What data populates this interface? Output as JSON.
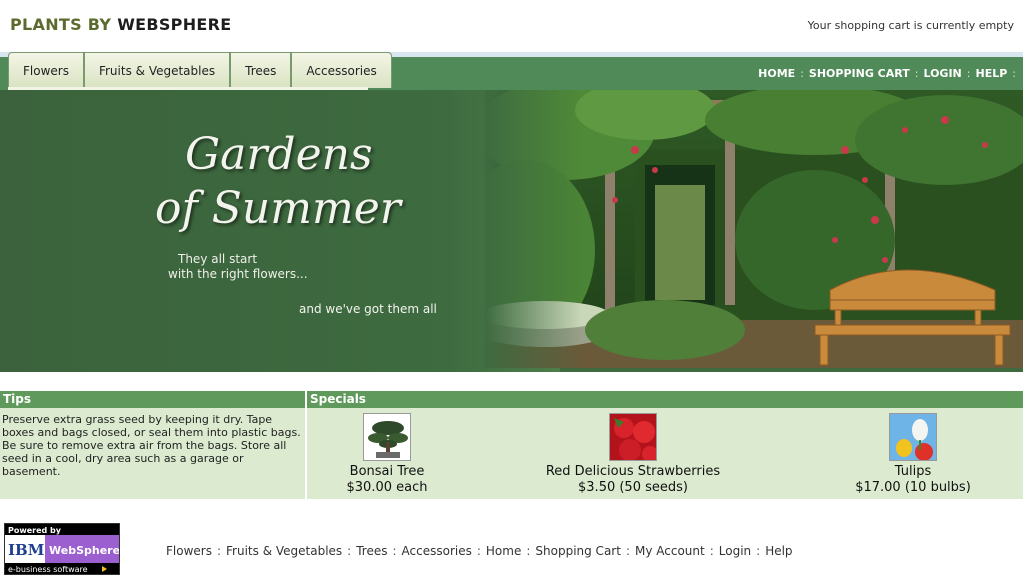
{
  "header": {
    "logo_part1": "PLANTS BY ",
    "logo_part2": "WEBSPHERE",
    "cart_status": "Your shopping cart is currently empty"
  },
  "nav": {
    "tabs": [
      {
        "label": "Flowers"
      },
      {
        "label": "Fruits & Vegetables"
      },
      {
        "label": "Trees"
      },
      {
        "label": "Accessories"
      }
    ],
    "toplinks": [
      "HOME",
      "SHOPPING CART",
      "LOGIN",
      "HELP"
    ]
  },
  "banner": {
    "title_line1": "Gardens",
    "title_line2": "of Summer",
    "sub_line1": "They all start",
    "sub_line2": "with the right flowers...",
    "tagline": "and we've got them all"
  },
  "tips": {
    "heading": "Tips",
    "text": "Preserve extra grass seed by keeping it dry. Tape boxes and bags closed, or seal them into plastic bags. Be sure to remove extra air from the bags. Store all seed in a cool, dry area such as a garage or basement."
  },
  "specials": {
    "heading": "Specials",
    "items": [
      {
        "name": "Bonsai Tree",
        "price": "$30.00 each",
        "icon": "bonsai-tree-image"
      },
      {
        "name": "Red Delicious Strawberries",
        "price": "$3.50 (50 seeds)",
        "icon": "strawberries-image"
      },
      {
        "name": "Tulips",
        "price": "$17.00 (10 bulbs)",
        "icon": "tulips-image"
      }
    ]
  },
  "powered_badge": {
    "line1": "Powered by",
    "brand1": "IBM",
    "brand2": "WebSphere",
    "line3": "e-business software"
  },
  "footer": {
    "links": [
      "Flowers",
      "Fruits & Vegetables",
      "Trees",
      "Accessories",
      "Home",
      "Shopping Cart",
      "My Account",
      "Login",
      "Help"
    ]
  },
  "colors": {
    "nav_green": "#4f8a58",
    "banner_green": "#3f6a3f",
    "panel_bg": "#dcebd0",
    "panel_head": "#5f9a5c",
    "logo_olive": "#5b6b2e"
  }
}
